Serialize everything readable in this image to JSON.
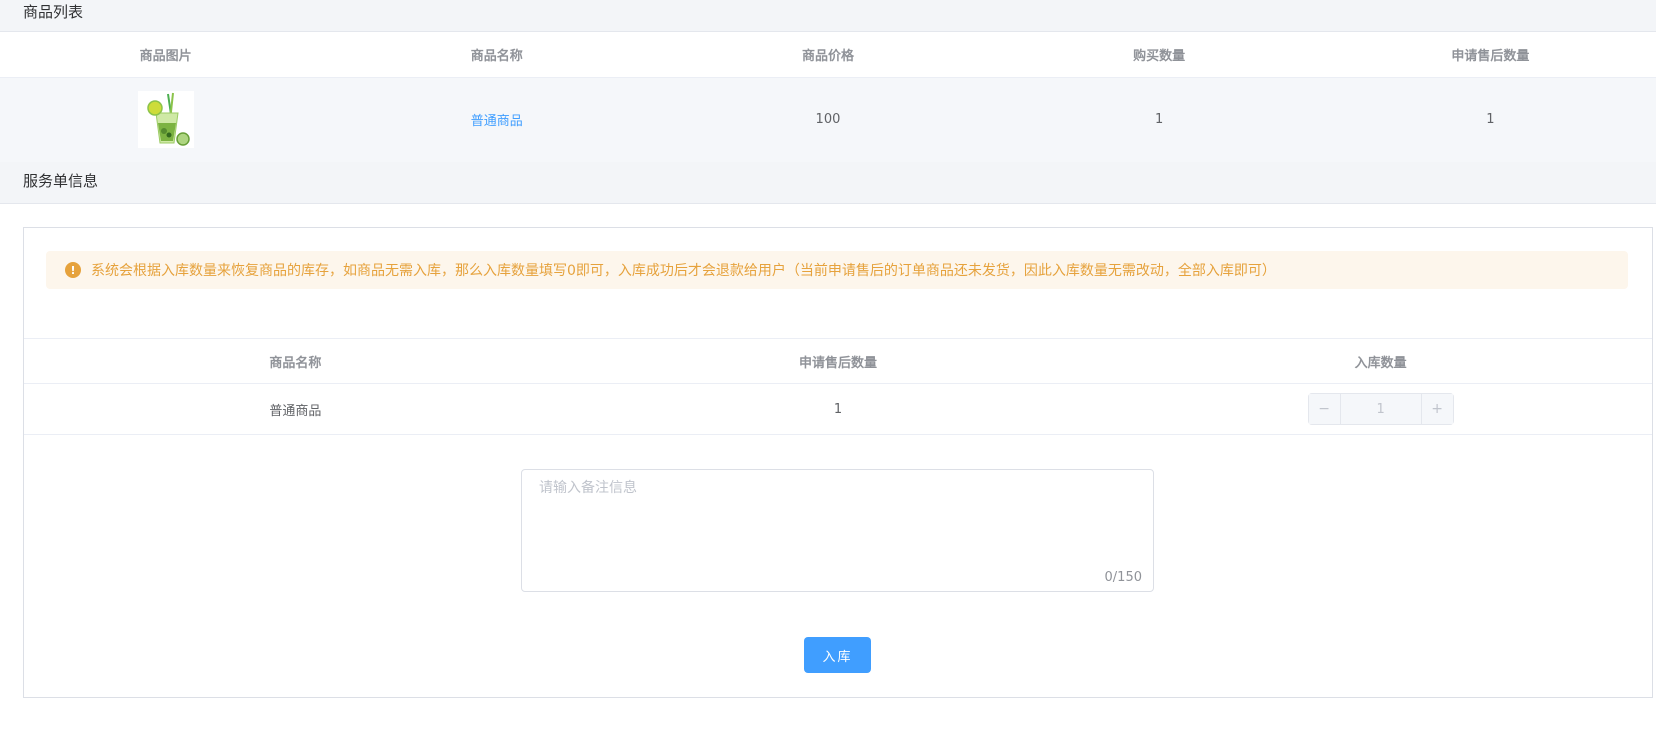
{
  "goods_list": {
    "title": "商品列表",
    "columns": [
      "商品图片",
      "商品名称",
      "商品价格",
      "购买数量",
      "申请售后数量"
    ],
    "rows": [
      {
        "image_icon": "lime-drink-image",
        "name": "普通商品",
        "price": "100",
        "buy_qty": "1",
        "after_sale_qty": "1"
      }
    ]
  },
  "service_info": {
    "title": "服务单信息",
    "alert": {
      "icon": "warning-icon",
      "text": "系统会根据入库数量来恢复商品的库存，如商品无需入库，那么入库数量填写0即可，入库成功后才会退款给用户（当前申请售后的订单商品还未发货，因此入库数量无需改动，全部入库即可）"
    },
    "columns": [
      "商品名称",
      "申请售后数量",
      "入库数量"
    ],
    "rows": [
      {
        "name": "普通商品",
        "after_sale_qty": "1",
        "stock_qty": "1"
      }
    ],
    "stepper": {
      "minus": "−",
      "plus": "+"
    },
    "remark": {
      "placeholder": "请输入备注信息",
      "value": "",
      "counter": "0/150"
    },
    "submit_label": "入库"
  },
  "colors": {
    "accent": "#409eff",
    "warning": "#e6a23c",
    "warning_bg": "#fdf6ec"
  }
}
